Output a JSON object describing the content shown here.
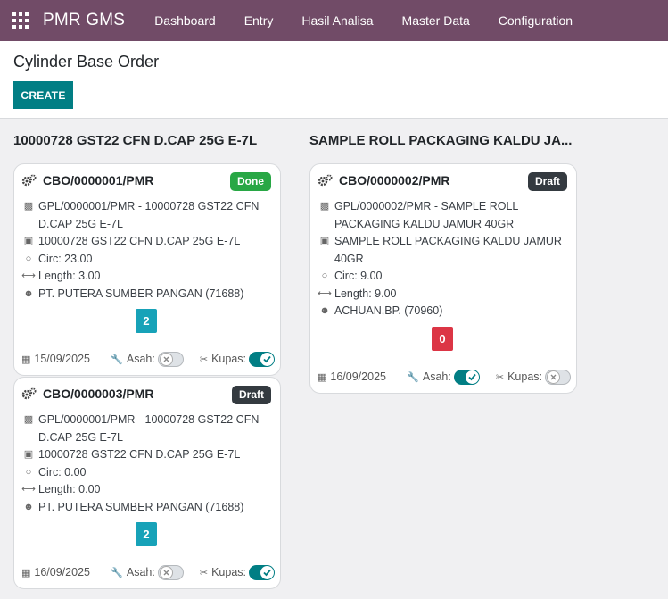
{
  "navbar": {
    "brand": "PMR GMS",
    "menu": [
      "Dashboard",
      "Entry",
      "Hasil Analisa",
      "Master Data",
      "Configuration"
    ]
  },
  "control_panel": {
    "title": "Cylinder Base Order",
    "create_label": "CREATE"
  },
  "columns": [
    {
      "title": "10000728 GST22 CFN D.CAP 25G E-7L",
      "cards": [
        {
          "reference": "CBO/0000001/PMR",
          "status": "Done",
          "plan": "GPL/0000001/PMR - 10000728 GST22 CFN D.CAP 25G E-7L",
          "product": "10000728 GST22 CFN D.CAP 25G E-7L",
          "circ": "Circ: 23.00",
          "length": "Length: 3.00",
          "customer": "PT. PUTERA SUMBER PANGAN (71688)",
          "count": "2",
          "date": "15/09/2025",
          "asah_label": "Asah:",
          "asah": false,
          "kupas_label": "Kupas:",
          "kupas": true
        },
        {
          "reference": "CBO/0000003/PMR",
          "status": "Draft",
          "plan": "GPL/0000001/PMR - 10000728 GST22 CFN D.CAP 25G E-7L",
          "product": "10000728 GST22 CFN D.CAP 25G E-7L",
          "circ": "Circ: 0.00",
          "length": "Length: 0.00",
          "customer": "PT. PUTERA SUMBER PANGAN (71688)",
          "count": "2",
          "date": "16/09/2025",
          "asah_label": "Asah:",
          "asah": false,
          "kupas_label": "Kupas:",
          "kupas": true
        }
      ]
    },
    {
      "title": "SAMPLE ROLL PACKAGING KALDU JA...",
      "cards": [
        {
          "reference": "CBO/0000002/PMR",
          "status": "Draft",
          "plan": "GPL/0000002/PMR - SAMPLE ROLL PACKAGING KALDU JAMUR 40GR",
          "product": "SAMPLE ROLL PACKAGING KALDU JAMUR 40GR",
          "circ": "Circ: 9.00",
          "length": "Length: 9.00",
          "customer": "ACHUAN,BP. (70960)",
          "count": "0",
          "date": "16/09/2025",
          "asah_label": "Asah:",
          "asah": true,
          "kupas_label": "Kupas:",
          "kupas": false
        }
      ]
    }
  ],
  "colors": {
    "navbar": "#714b67",
    "primary": "#017e84",
    "done": "#28a745",
    "draft": "#343a40",
    "counter_teal": "#17a2b8",
    "counter_red": "#dc3545"
  }
}
